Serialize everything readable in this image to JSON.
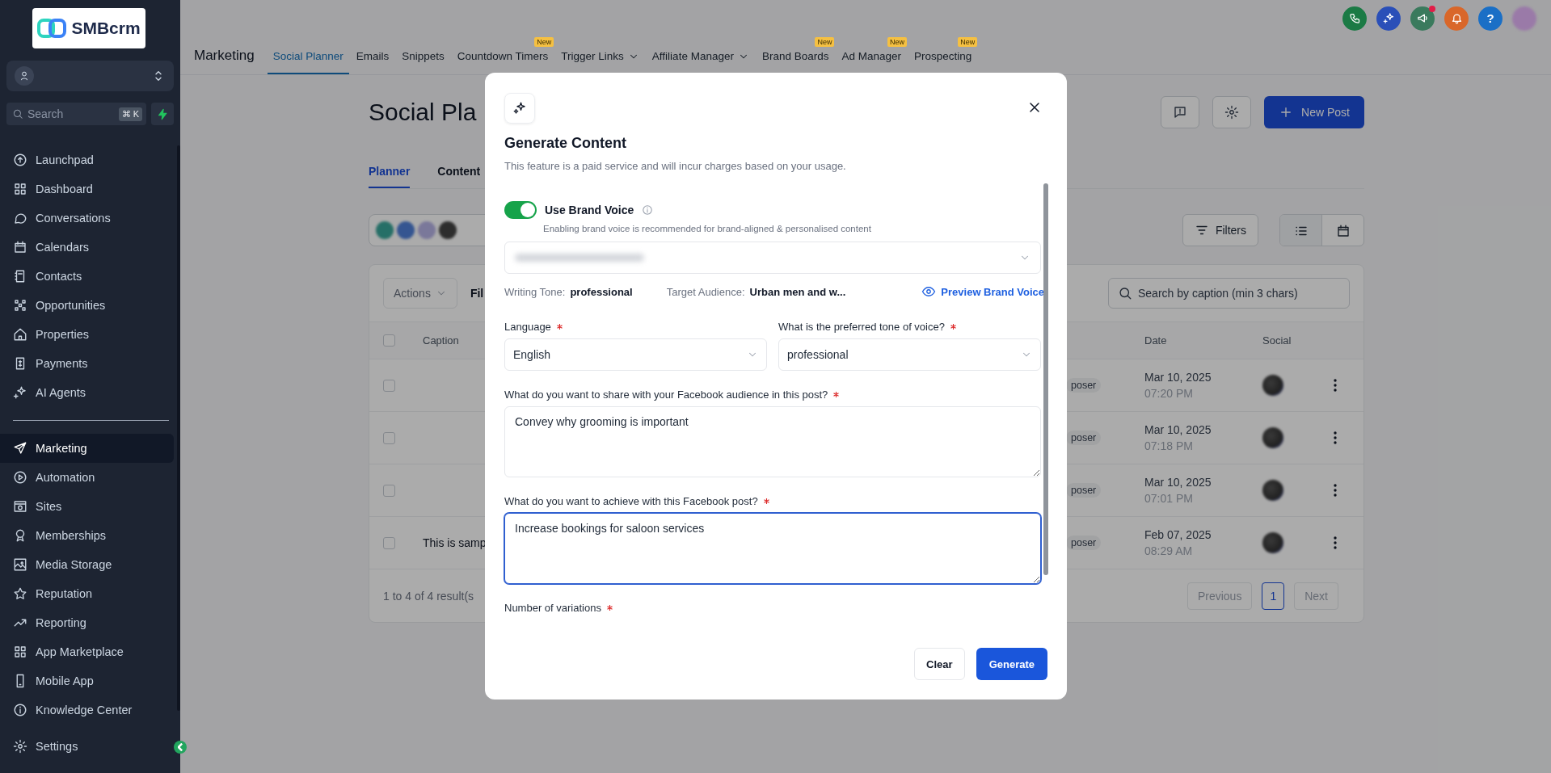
{
  "sidebar": {
    "logo_text": "SMBcrm",
    "search": {
      "placeholder": "Search",
      "shortcut": "⌘ K"
    },
    "items": [
      {
        "label": "Launchpad",
        "selected": false
      },
      {
        "label": "Dashboard",
        "selected": false
      },
      {
        "label": "Conversations",
        "selected": false
      },
      {
        "label": "Calendars",
        "selected": false
      },
      {
        "label": "Contacts",
        "selected": false
      },
      {
        "label": "Opportunities",
        "selected": false
      },
      {
        "label": "Properties",
        "selected": false
      },
      {
        "label": "Payments",
        "selected": false
      },
      {
        "label": "AI Agents",
        "selected": false
      }
    ],
    "items_2": [
      {
        "label": "Marketing",
        "selected": true
      },
      {
        "label": "Automation",
        "selected": false
      },
      {
        "label": "Sites",
        "selected": false
      },
      {
        "label": "Memberships",
        "selected": false
      },
      {
        "label": "Media Storage",
        "selected": false
      },
      {
        "label": "Reputation",
        "selected": false
      },
      {
        "label": "Reporting",
        "selected": false
      },
      {
        "label": "App Marketplace",
        "selected": false
      },
      {
        "label": "Mobile App",
        "selected": false
      },
      {
        "label": "Knowledge Center",
        "selected": false
      }
    ],
    "settings": {
      "label": "Settings",
      "selected": false
    }
  },
  "header": {
    "actions": [
      {
        "kind": "phone",
        "color": "#1b7a45",
        "notification": false
      },
      {
        "kind": "sparkle",
        "color": "#2a4fb8",
        "notification": false
      },
      {
        "kind": "megaphone",
        "color": "#3a7a5d",
        "notification": true
      },
      {
        "kind": "bell",
        "color": "#d9672a",
        "notification": false
      },
      {
        "kind": "help",
        "color": "#1a6fc6",
        "label": "?",
        "notification": false
      },
      {
        "kind": "avatar",
        "color": "#9a7aa8",
        "notification": false
      }
    ],
    "section": "Marketing",
    "nav": [
      {
        "label": "Social Planner",
        "selected": true,
        "dropdown": false
      },
      {
        "label": "Emails",
        "selected": false,
        "dropdown": false
      },
      {
        "label": "Snippets",
        "selected": false,
        "dropdown": false
      },
      {
        "label": "Countdown Timers",
        "selected": false,
        "dropdown": false,
        "badge": "New"
      },
      {
        "label": "Trigger Links",
        "selected": false,
        "dropdown": true
      },
      {
        "label": "Affiliate Manager",
        "selected": false,
        "dropdown": true
      },
      {
        "label": "Brand Boards",
        "selected": false,
        "dropdown": false,
        "badge": "New"
      },
      {
        "label": "Ad Manager",
        "selected": false,
        "dropdown": false,
        "badge": "New"
      },
      {
        "label": "Prospecting",
        "selected": false,
        "dropdown": false,
        "badge": "New"
      }
    ]
  },
  "page": {
    "title": "Social Pla",
    "new_post": "New Post",
    "tabs": [
      {
        "label": "Planner",
        "selected": true
      },
      {
        "label": "Content",
        "selected": false
      }
    ],
    "filters": "Filters",
    "views": [
      {
        "kind": "list",
        "selected": true
      },
      {
        "kind": "calendar",
        "selected": false
      }
    ]
  },
  "table": {
    "actions": "Actions",
    "filter_label": "Fil",
    "search_placeholder": "Search by caption (min 3 chars)",
    "select_all_checked": false,
    "columns": [
      "Caption",
      "Date",
      "Social"
    ],
    "rows": [
      {
        "checked": false,
        "type": "poser",
        "date": "Mar 10, 2025",
        "time": "07:20 PM"
      },
      {
        "checked": false,
        "type": "poser",
        "date": "Mar 10, 2025",
        "time": "07:18 PM"
      },
      {
        "checked": false,
        "type": "poser",
        "date": "Mar 10, 2025",
        "time": "07:01 PM"
      },
      {
        "checked": false,
        "caption": "This is samp",
        "type": "poser",
        "date": "Feb 07, 2025",
        "time": "08:29 AM"
      }
    ],
    "summary": "1 to 4 of 4 result(s",
    "previous": "Previous",
    "pages": [
      {
        "label": "1",
        "selected": true
      }
    ],
    "next": "Next"
  },
  "modal": {
    "title": "Generate Content",
    "subtitle": "This feature is a paid service and will incur charges based on your usage.",
    "brand_voice": {
      "label": "Use Brand Voice",
      "on": true,
      "hint": "Enabling brand voice is recommended for brand-aligned & personalised content",
      "writing_tone_label": "Writing Tone:",
      "writing_tone": "professional",
      "audience_label": "Target Audience:",
      "audience": "Urban men and w...",
      "preview_link": "Preview Brand Voice"
    },
    "fields": [
      {
        "kind": "select",
        "label": "Language",
        "required": true,
        "value": "English"
      },
      {
        "kind": "select",
        "label": "What is the preferred tone of voice?",
        "required": true,
        "value": "professional"
      },
      {
        "kind": "textarea",
        "label": "What do you want to share with your Facebook audience in this post?",
        "required": true,
        "value": "Convey why grooming is important",
        "focused": false
      },
      {
        "kind": "textarea",
        "label": "What do you want to achieve with this Facebook post?",
        "required": true,
        "value": "Increase bookings for saloon services",
        "focused": true
      },
      {
        "kind": "number",
        "label": "Number of variations",
        "required": true
      }
    ],
    "buttons": [
      {
        "label": "Clear",
        "kind": "secondary"
      },
      {
        "label": "Generate",
        "kind": "primary"
      }
    ]
  }
}
